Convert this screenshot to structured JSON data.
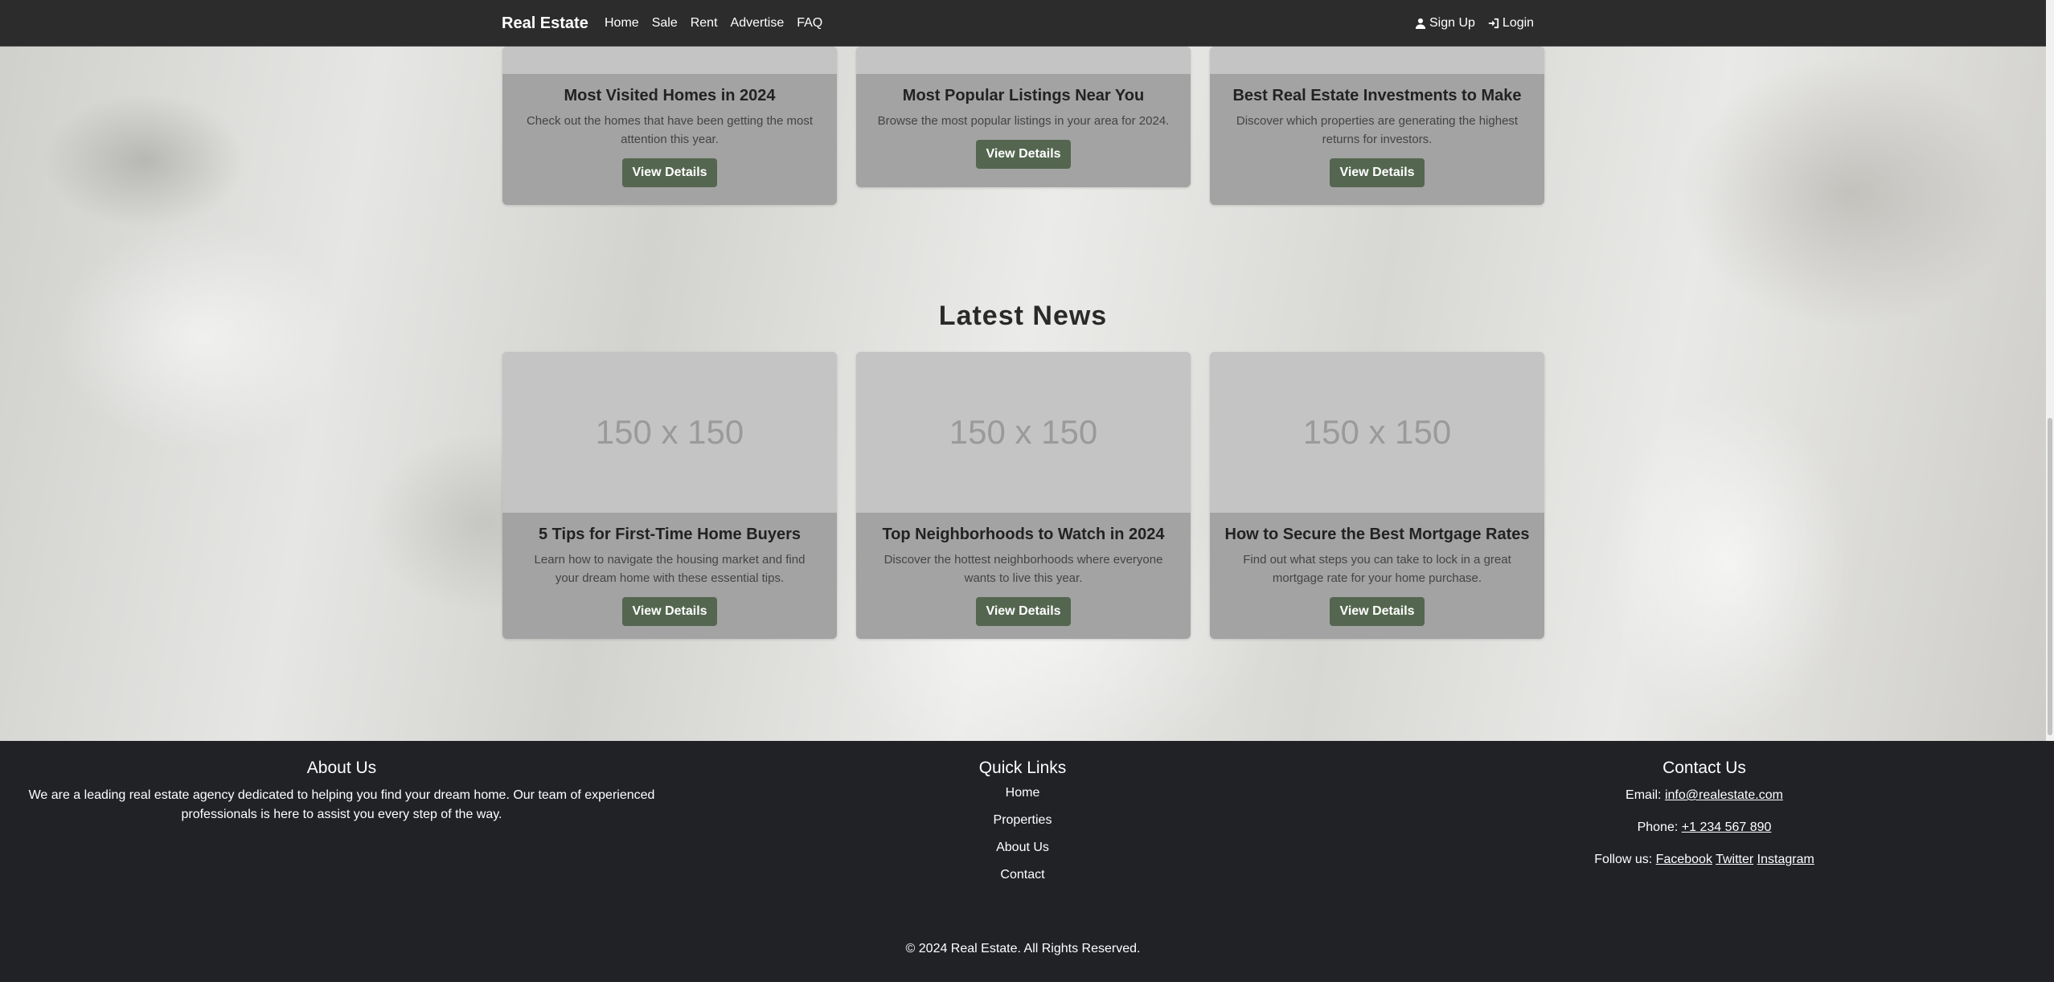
{
  "navbar": {
    "brand": "Real Estate",
    "links": [
      "Home",
      "Sale",
      "Rent",
      "Advertise",
      "FAQ"
    ],
    "signup": "Sign Up",
    "login": "Login"
  },
  "featured": [
    {
      "title": "Most Visited Homes in 2024",
      "text": "Check out the homes that have been getting the most attention this year.",
      "button": "View Details"
    },
    {
      "title": "Most Popular Listings Near You",
      "text": "Browse the most popular listings in your area for 2024.",
      "button": "View Details"
    },
    {
      "title": "Best Real Estate Investments to Make",
      "text": "Discover which properties are generating the highest returns for investors.",
      "button": "View Details"
    }
  ],
  "news": {
    "title": "Latest News",
    "cards": [
      {
        "image": "150 x 150",
        "title": "5 Tips for First-Time Home Buyers",
        "text": "Learn how to navigate the housing market and find your dream home with these essential tips.",
        "button": "View Details"
      },
      {
        "image": "150 x 150",
        "title": "Top Neighborhoods to Watch in 2024",
        "text": "Discover the hottest neighborhoods where everyone wants to live this year.",
        "button": "View Details"
      },
      {
        "image": "150 x 150",
        "title": "How to Secure the Best Mortgage Rates",
        "text": "Find out what steps you can take to lock in a great mortgage rate for your home purchase.",
        "button": "View Details"
      }
    ]
  },
  "footer": {
    "about": {
      "title": "About Us",
      "text": "We are a leading real estate agency dedicated to helping you find your dream home. Our team of experienced professionals is here to assist you every step of the way."
    },
    "quick_links": {
      "title": "Quick Links",
      "items": [
        "Home",
        "Properties",
        "About Us",
        "Contact"
      ]
    },
    "contact": {
      "title": "Contact Us",
      "email_label": "Email:",
      "email": "info@realestate.com",
      "phone_label": "Phone:",
      "phone": "+1 234 567 890",
      "follow_label": "Follow us:",
      "social": [
        "Facebook",
        "Twitter",
        "Instagram"
      ]
    },
    "copyright": "© 2024 Real Estate. All Rights Reserved."
  }
}
